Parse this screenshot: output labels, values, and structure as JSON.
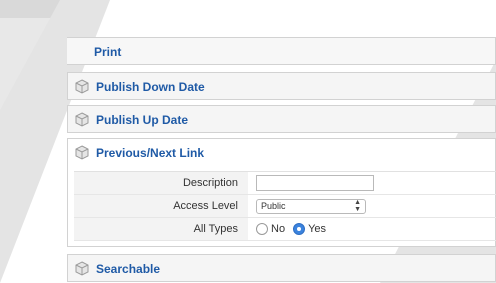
{
  "panels": {
    "print": {
      "label": "Print"
    },
    "publish_down": {
      "label": "Publish Down Date"
    },
    "publish_up": {
      "label": "Publish Up Date"
    },
    "prev_next": {
      "label": "Previous/Next Link",
      "fields": {
        "description": {
          "label": "Description",
          "value": ""
        },
        "access_level": {
          "label": "Access Level",
          "value": "Public"
        },
        "all_types": {
          "label": "All Types",
          "options": [
            "No",
            "Yes"
          ],
          "selected": "Yes"
        }
      }
    },
    "searchable": {
      "label": "Searchable"
    }
  },
  "icons": {
    "panel_icon": "cube-icon",
    "dropdown_icon": "chevron-updown-icon"
  },
  "colors": {
    "title_blue": "#1f5aa6",
    "radio_active": "#3b83de"
  }
}
